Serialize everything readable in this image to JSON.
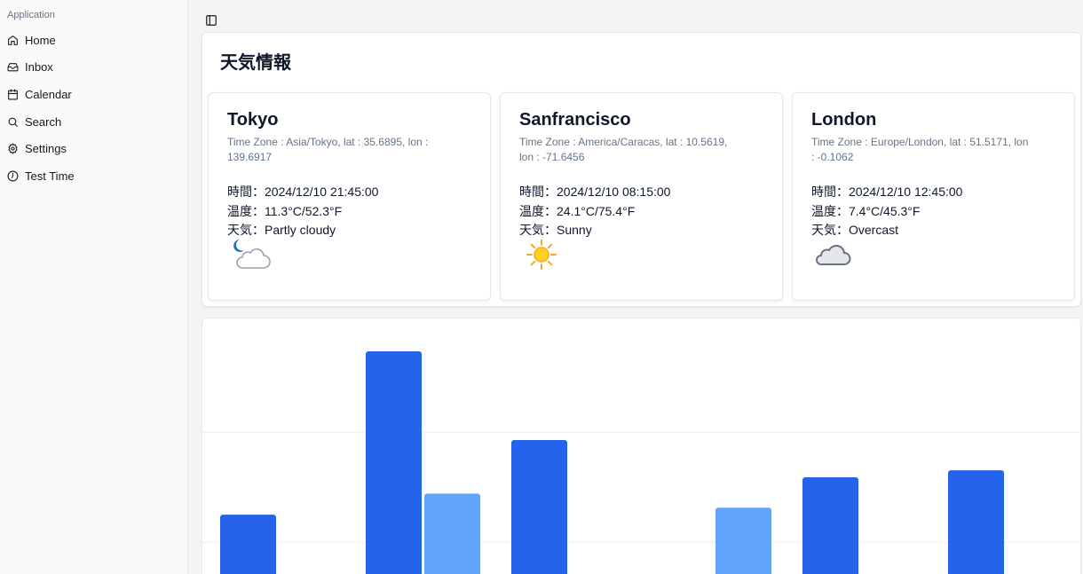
{
  "sidebar": {
    "group_label": "Application",
    "items": [
      {
        "label": "Home",
        "icon": "home-icon"
      },
      {
        "label": "Inbox",
        "icon": "inbox-icon"
      },
      {
        "label": "Calendar",
        "icon": "calendar-icon"
      },
      {
        "label": "Search",
        "icon": "search-icon"
      },
      {
        "label": "Settings",
        "icon": "settings-icon"
      },
      {
        "label": "Test Time",
        "icon": "clock-icon"
      }
    ]
  },
  "header": {
    "toggle_icon": "sidebar-toggle-icon"
  },
  "panel": {
    "title": "天気情報"
  },
  "cities": [
    {
      "name": "Tokyo",
      "tz": "Time Zone : Asia/Tokyo, lat : 35.6895, lon : 139.6917",
      "time_key": "時間：",
      "time": "2024/12/10 21:45:00",
      "temp_key": "温度：",
      "temp": "11.3°C/52.3°F",
      "weather_key": "天気：",
      "weather": "Partly cloudy",
      "icon": "partly-cloudy-night-icon"
    },
    {
      "name": "Sanfrancisco",
      "tz": "Time Zone : America/Caracas, lat : 10.5619, lon : -71.6456",
      "time_key": "時間：",
      "time": "2024/12/10 08:15:00",
      "temp_key": "温度：",
      "temp": "24.1°C/75.4°F",
      "weather_key": "天気：",
      "weather": "Sunny",
      "icon": "sunny-icon"
    },
    {
      "name": "London",
      "tz": "Time Zone : Europe/London, lat : 51.5171, lon : -0.1062",
      "time_key": "時間：",
      "time": "2024/12/10 12:45:00",
      "temp_key": "温度：",
      "temp": "7.4°C/45.3°F",
      "weather_key": "天気：",
      "weather": "Overcast",
      "icon": "overcast-icon"
    }
  ],
  "colors": {
    "primary_bar": "#2563eb",
    "secondary_bar": "#60a5fa",
    "grid": "#eeeeee"
  },
  "chart_data": {
    "type": "bar",
    "categories": [
      "",
      "",
      "",
      "",
      "",
      "",
      ""
    ],
    "series": [
      {
        "values": [
          3,
          10,
          6.2,
          0,
          4.6,
          4.9,
          0
        ]
      },
      {
        "values": [
          0,
          3.9,
          0,
          3.3,
          0,
          0.15,
          0
        ]
      }
    ],
    "ylim": [
      0,
      11
    ],
    "grid": true
  }
}
